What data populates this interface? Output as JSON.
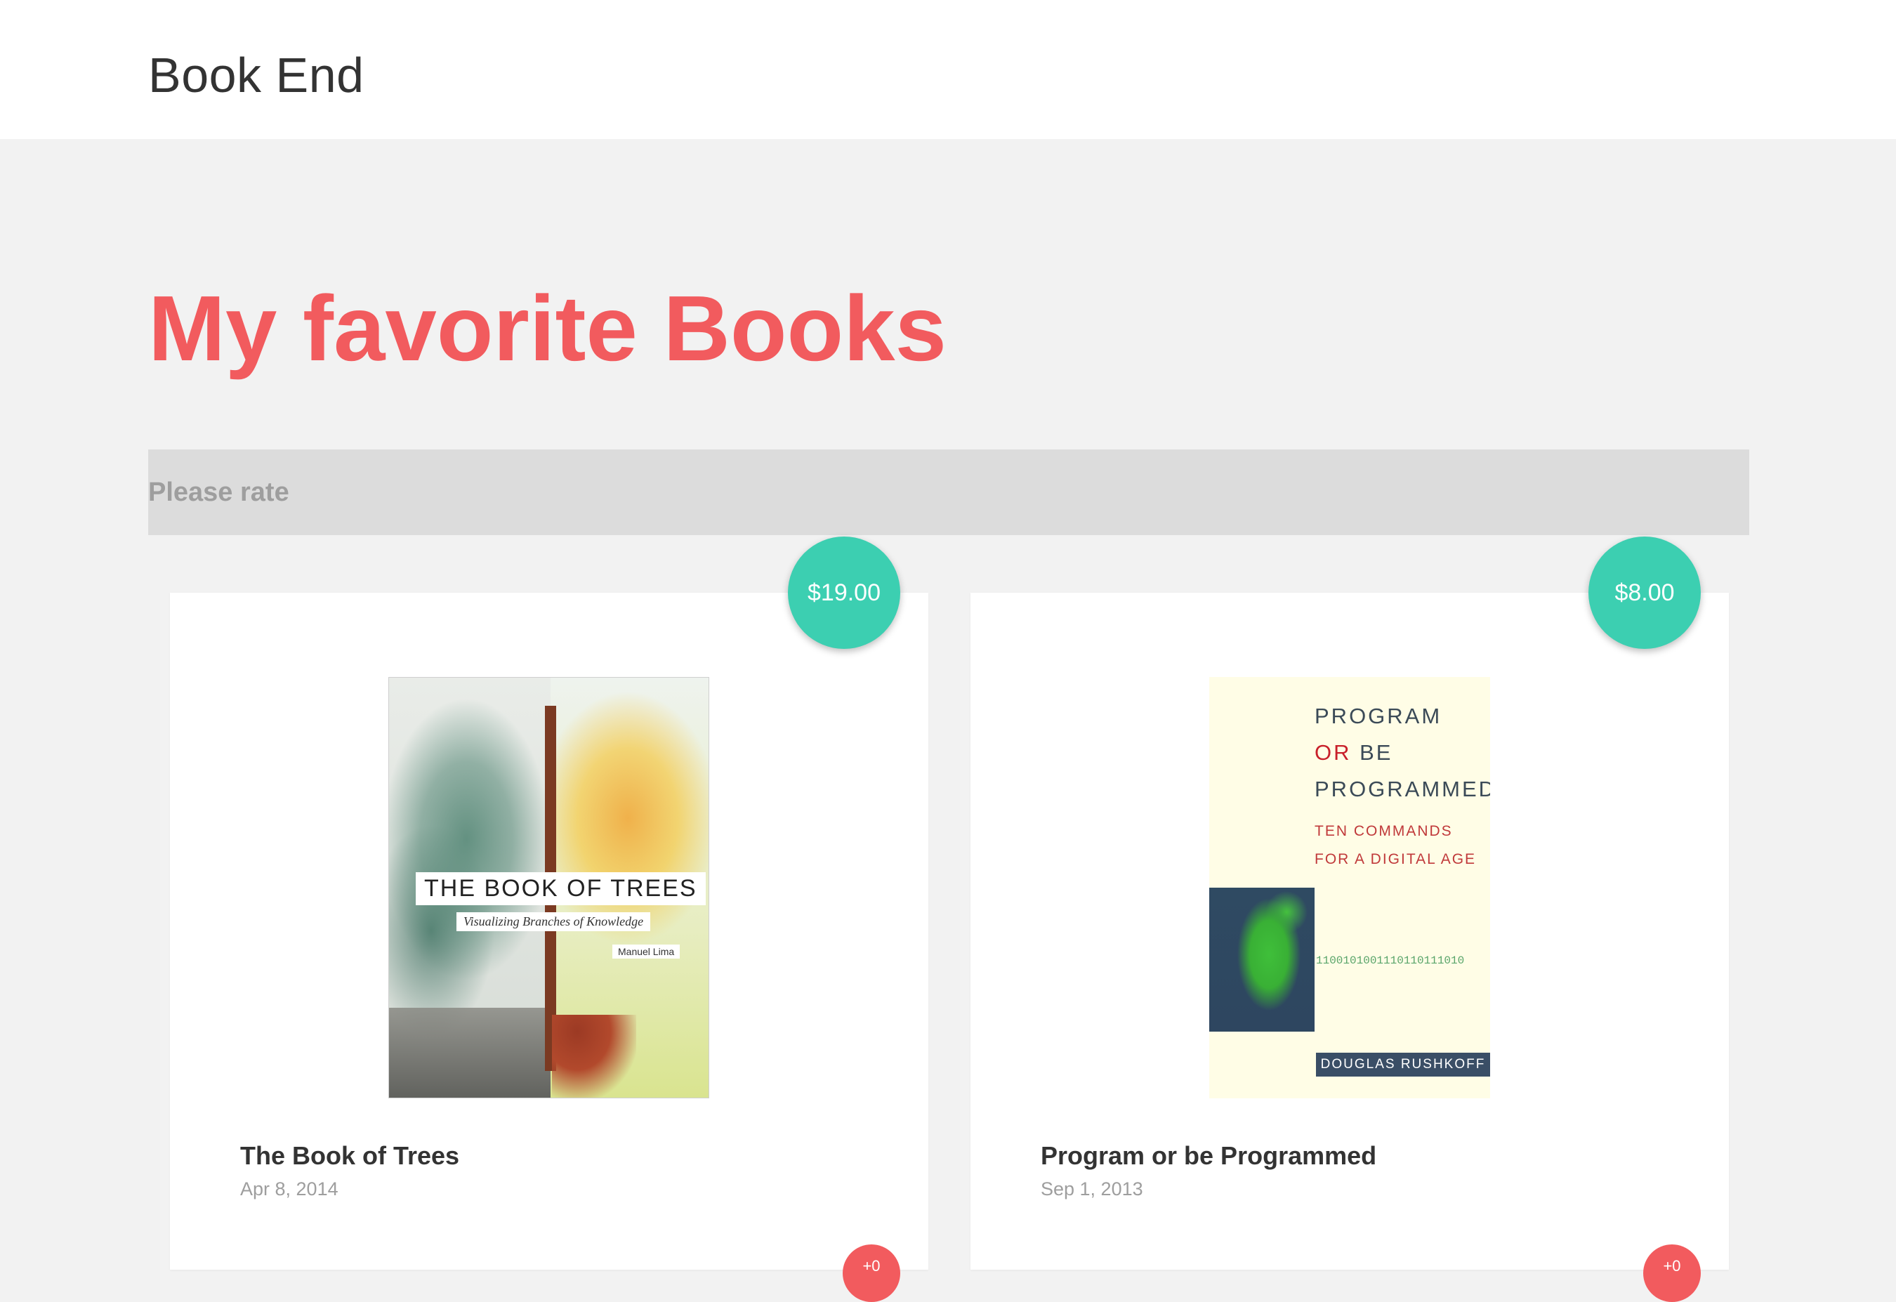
{
  "app": {
    "brand": "Book End"
  },
  "page": {
    "title": "My favorite Books"
  },
  "rating_bar": {
    "label": "Please rate"
  },
  "colors": {
    "accent": "#f25b5e",
    "price_badge": "#3ccfb1",
    "rating_badge": "#f25b5e"
  },
  "books": [
    {
      "title": "The Book of Trees",
      "date": "Apr 8, 2014",
      "price": "$19.00",
      "rating_badge": "+0",
      "cover": {
        "title": "THE BOOK OF TREES",
        "subtitle": "Visualizing Branches of Knowledge",
        "author": "Manuel Lima"
      }
    },
    {
      "title": "Program or be Programmed",
      "date": "Sep 1, 2013",
      "price": "$8.00",
      "rating_badge": "+0",
      "cover": {
        "line1": "PROGRAM",
        "line2_or": "OR",
        "line2_be": "BE",
        "line3": "PROGRAMMED",
        "sub1": "TEN COMMANDS",
        "sub2": "FOR A DIGITAL AGE",
        "binary": "1100101001110110111010",
        "author": "DOUGLAS RUSHKOFF"
      }
    }
  ]
}
